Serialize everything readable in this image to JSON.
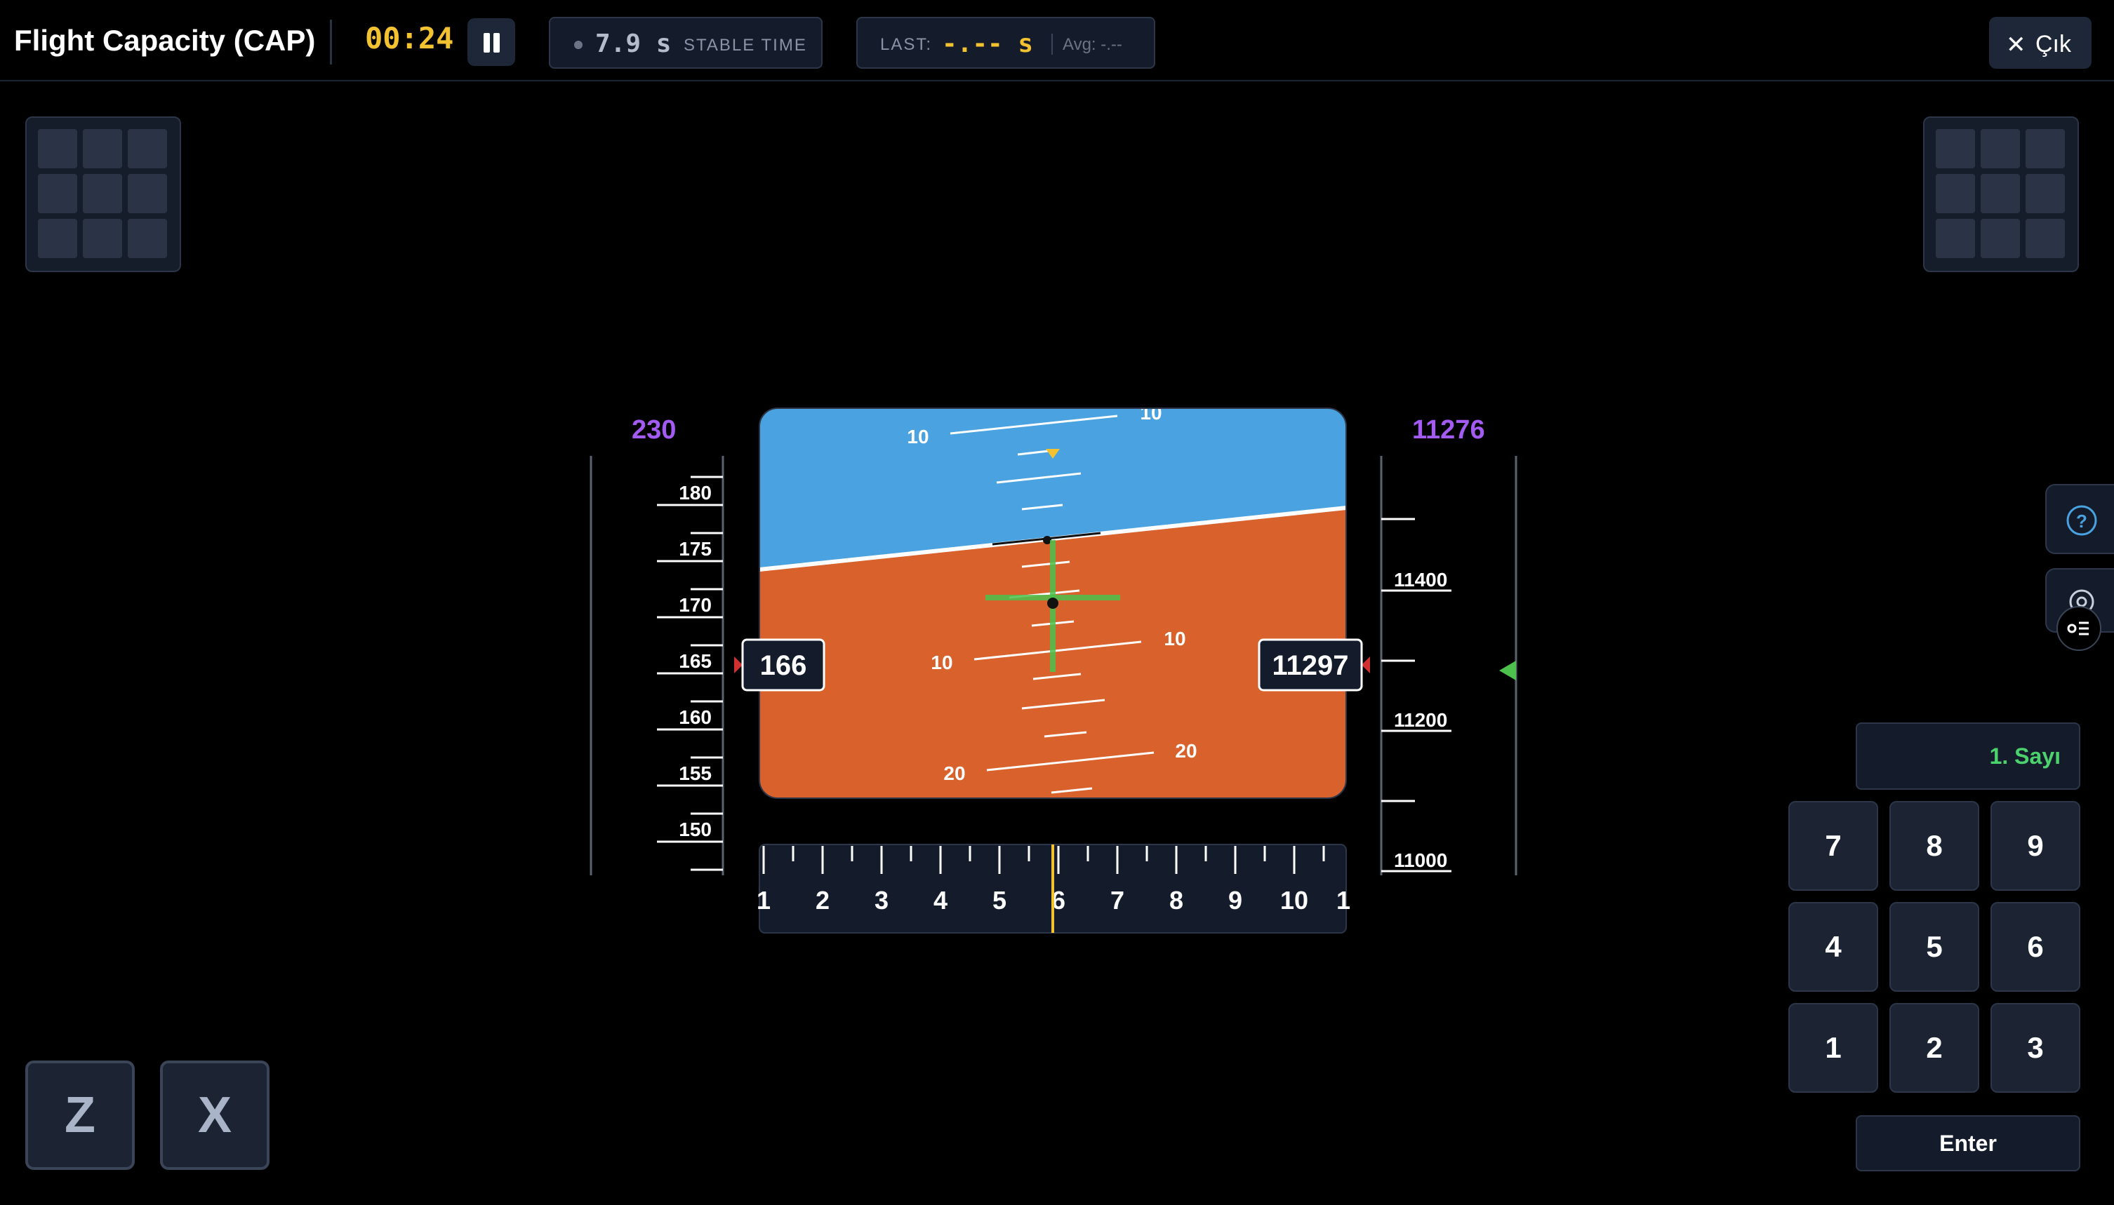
{
  "header": {
    "title": "Flight Capacity (CAP)",
    "timer": "00:24",
    "stable_value": "7.9 s",
    "stable_label": "STABLE TIME",
    "last_label": "LAST:",
    "last_value": "-.-- s",
    "avg": "Avg: -.--",
    "exit_label": "Çık"
  },
  "instrument": {
    "speed_target": "230",
    "speed_current": "166",
    "speed_ticks": [
      "180",
      "175",
      "170",
      "165",
      "160",
      "155",
      "150"
    ],
    "altitude_target": "11276",
    "altitude_current": "11297",
    "altitude_ticks": [
      "11400",
      "11200",
      "11000"
    ],
    "pitch_labels": [
      "10",
      "10",
      "10",
      "10",
      "20",
      "20"
    ],
    "heading_ticks": [
      "1",
      "2",
      "3",
      "4",
      "5",
      "6",
      "7",
      "8",
      "9",
      "10",
      "1"
    ],
    "sky_color": "#4aa2e0",
    "ground_color": "#d8612c",
    "target_color": "#a35bf2",
    "crosshair_color": "#4cc24c"
  },
  "keypad": {
    "display_label": "1. Sayı",
    "keys": [
      "7",
      "8",
      "9",
      "4",
      "5",
      "6",
      "1",
      "2",
      "3"
    ],
    "enter_label": "Enter"
  },
  "controls": {
    "z_label": "Z",
    "x_label": "X"
  },
  "icons": {
    "pause": "pause-icon",
    "close": "close-icon",
    "help": "help-icon",
    "settings": "gear-icon",
    "list": "list-settings-icon"
  }
}
